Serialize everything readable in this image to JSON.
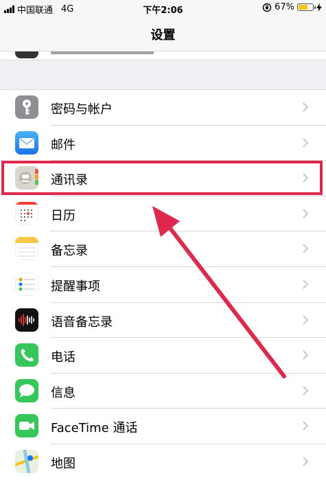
{
  "status_bar": {
    "carrier": "中国联通",
    "network": "4G",
    "time": "下午2:06",
    "battery": "67%",
    "battery_level": 0.67
  },
  "nav": {
    "title": "设置"
  },
  "rows": [
    {
      "label": "密码与帐户",
      "icon": "key-icon"
    },
    {
      "label": "邮件",
      "icon": "mail-icon"
    },
    {
      "label": "通讯录",
      "icon": "contacts-icon"
    },
    {
      "label": "日历",
      "icon": "calendar-icon"
    },
    {
      "label": "备忘录",
      "icon": "notes-icon"
    },
    {
      "label": "提醒事项",
      "icon": "reminders-icon"
    },
    {
      "label": "语音备忘录",
      "icon": "voice-memos-icon"
    },
    {
      "label": "电话",
      "icon": "phone-icon"
    },
    {
      "label": "信息",
      "icon": "messages-icon"
    },
    {
      "label": "FaceTime 通话",
      "icon": "facetime-icon"
    },
    {
      "label": "地图",
      "icon": "maps-icon"
    }
  ],
  "colors": {
    "highlight": "#e0284c",
    "battery": "#f5c518",
    "chevron": "#c7c7cc"
  }
}
